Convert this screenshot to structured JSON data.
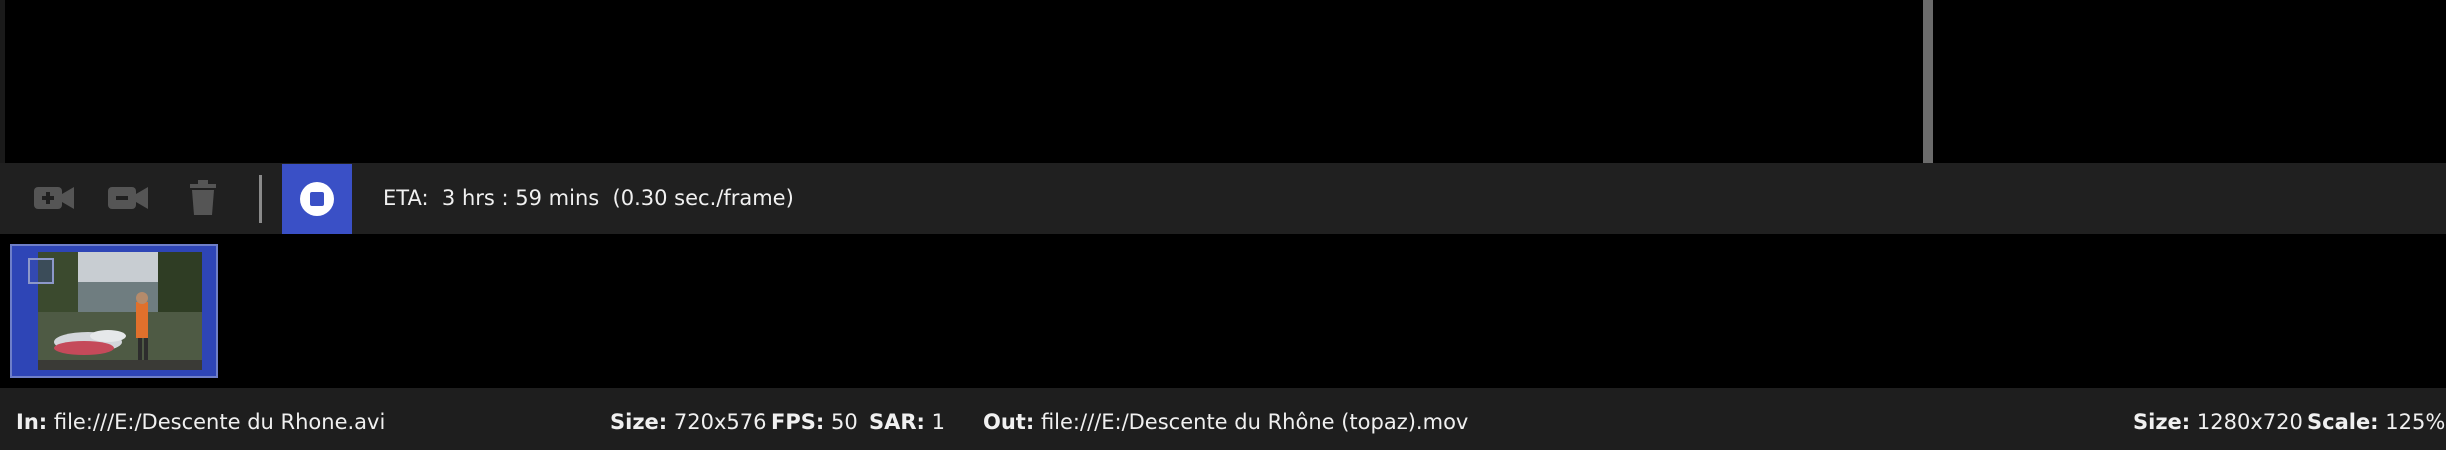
{
  "toolbar": {
    "add_video_icon": "video-plus-icon",
    "remove_video_icon": "video-minus-icon",
    "delete_icon": "trash-icon",
    "stop_icon": "stop-icon",
    "eta_label": "ETA:",
    "eta_value": "3 hrs : 59 mins  (0.30 sec./frame)"
  },
  "queue": {
    "items": [
      {
        "checked": true
      }
    ]
  },
  "status": {
    "in_label": "In:",
    "in_value": "file:///E:/Descente du Rhone.avi",
    "size_label": "Size:",
    "size_value": "720x576",
    "fps_label": "FPS:",
    "fps_value": "50",
    "sar_label": "SAR:",
    "sar_value": "1",
    "out_label": "Out:",
    "out_value": "file:///E:/Descente du Rhône (topaz).mov",
    "out_size_label": "Size:",
    "out_size_value": "1280x720",
    "scale_label": "Scale:",
    "scale_value": "125%"
  },
  "colors": {
    "accent": "#3a50c6",
    "background": "#000000",
    "bar": "#202020"
  }
}
